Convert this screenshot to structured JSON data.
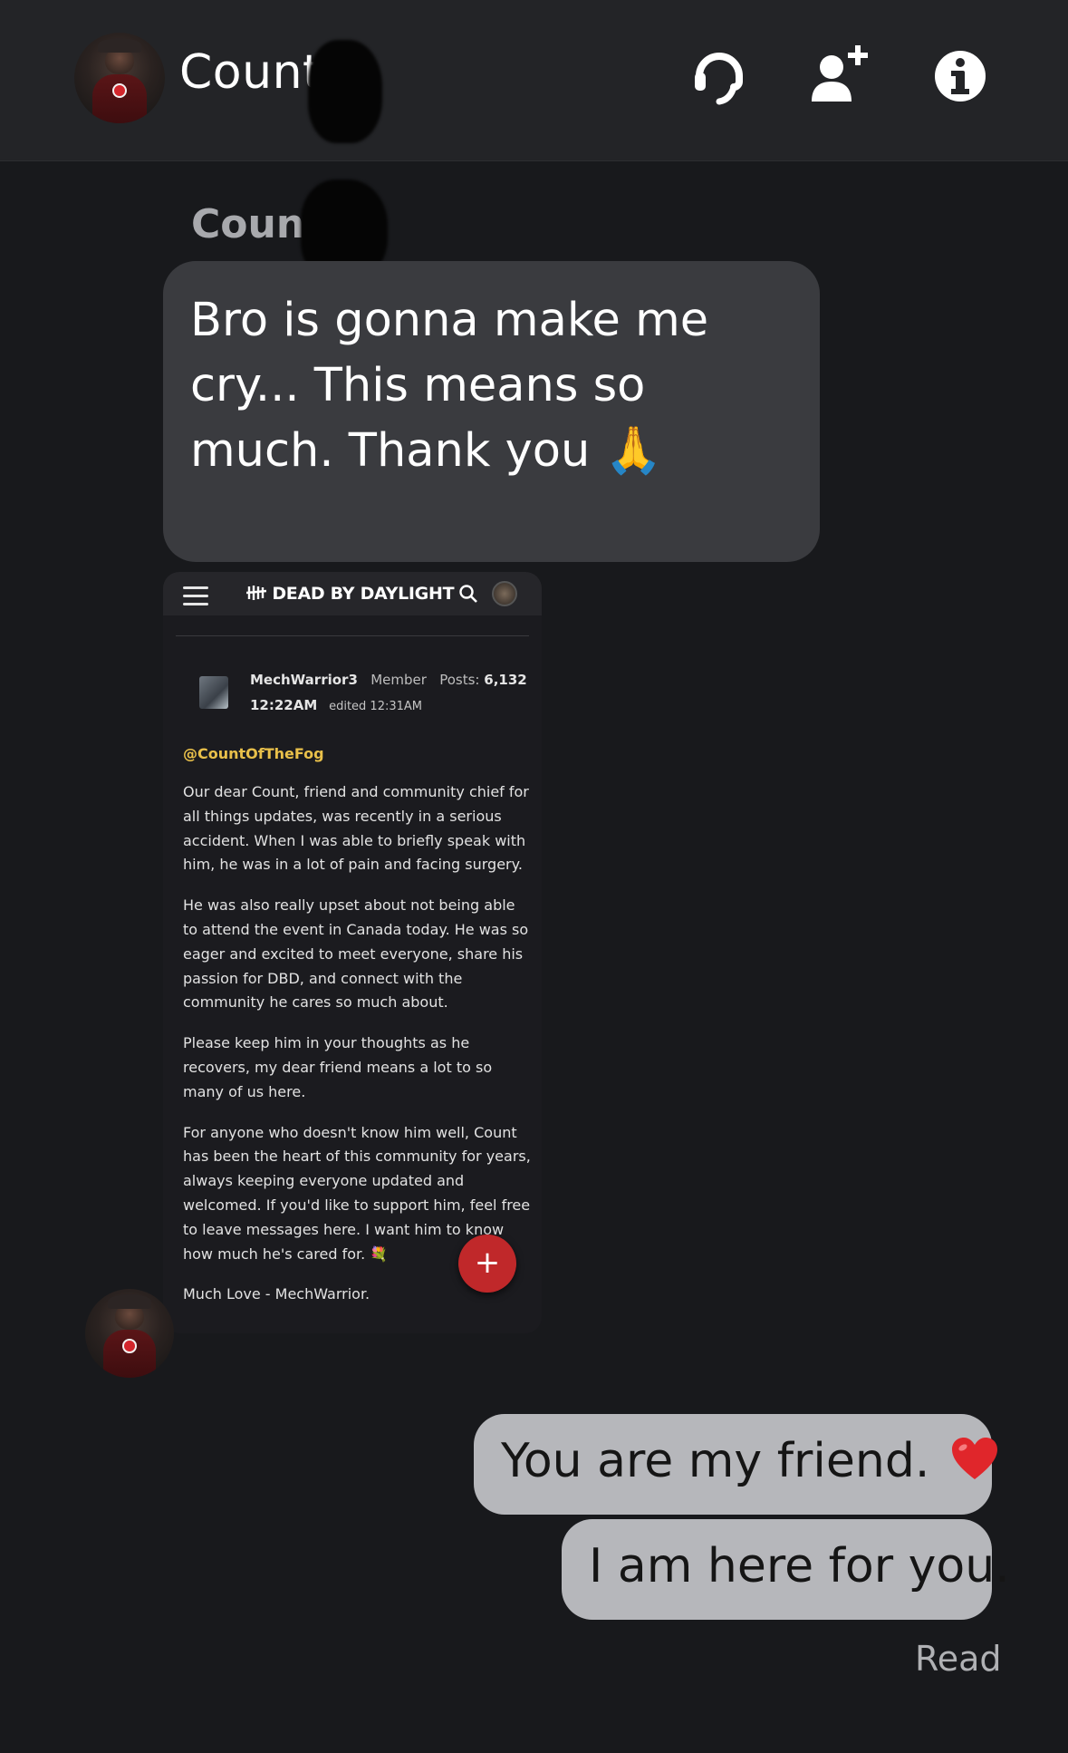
{
  "header": {
    "contact_name": "Count",
    "icons": [
      "voice-chat-icon",
      "add-friend-icon",
      "info-icon"
    ]
  },
  "conversation": {
    "incoming_sender": "Count",
    "incoming_message": "Bro is gonna make me cry... This means so much. Thank you 🙏",
    "attachment": {
      "site_title": "DEAD BY DAYLIGHT",
      "username": "MechWarrior3",
      "role": "Member",
      "posts_label": "Posts:",
      "posts_count": "6,132",
      "time": "12:22AM",
      "edited": "edited 12:31AM",
      "mention": "@CountOfTheFog",
      "paragraphs": [
        "Our dear Count, friend and community chief for all things updates, was recently in a serious accident. When I was able to briefly speak with him, he was in a lot of pain and facing surgery.",
        "He was also really upset about not being able to attend the event in Canada today. He was so eager and excited to meet everyone, share his passion for DBD, and connect with the community he cares so much about.",
        "Please keep him in your thoughts as he recovers, my dear friend means a lot to so many of us here.",
        "For anyone who doesn't know him well, Count has been the heart of this community for years, always keeping everyone updated and welcomed. If you'd like to support him, feel free to leave messages here. I want him to know how much he's cared for. 💐"
      ],
      "signoff": "Much Love - MechWarrior.",
      "fab_label": "+"
    },
    "outgoing_messages": [
      "You are my friend.",
      "I am here for you."
    ],
    "read_receipt": "Read"
  },
  "colors": {
    "background": "#18191c",
    "header": "#232427",
    "incoming_bubble": "#3a3b3f",
    "outgoing_bubble": "#b6b7bb",
    "heart": "#e0262b",
    "mention": "#e9c04a",
    "fab": "#c0282a"
  }
}
